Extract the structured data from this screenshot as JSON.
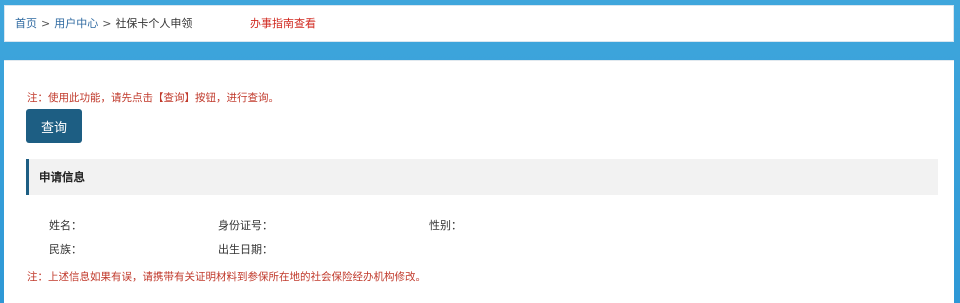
{
  "breadcrumb": {
    "items": [
      "首页",
      "用户中心",
      "社保卡个人申领"
    ],
    "separator": ">"
  },
  "guide_link": "办事指南查看",
  "notice_top": "注：使用此功能，请先点击【查询】按钮，进行查询。",
  "query_button": "查询",
  "section_title": "申请信息",
  "fields": {
    "name": {
      "label": "姓名：",
      "value": ""
    },
    "id_number": {
      "label": "身份证号：",
      "value": ""
    },
    "gender": {
      "label": "性别：",
      "value": ""
    },
    "ethnicity": {
      "label": "民族：",
      "value": ""
    },
    "birth_date": {
      "label": "出生日期：",
      "value": ""
    }
  },
  "notice_bottom": "注：上述信息如果有误，请携带有关证明材料到参保所在地的社会保险经办机构修改。",
  "colors": {
    "background": "#3fa6dc",
    "button": "#1d5e83",
    "notice": "#c0392b",
    "guide_link": "#d0281f"
  }
}
